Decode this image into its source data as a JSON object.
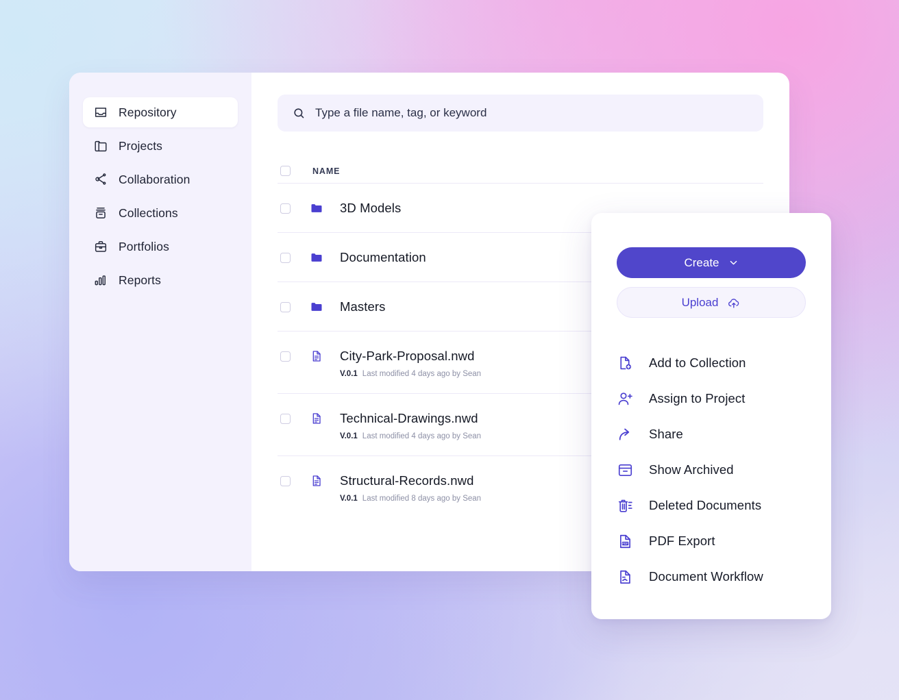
{
  "theme": {
    "accent": "#5046cb",
    "accent_light": "#4a3fd0",
    "panel_bg": "#ffffff",
    "sidebar_bg": "#f4f2fd",
    "field_bg": "#f4f2fd",
    "text": "#141824",
    "muted": "#8d90a6"
  },
  "sidebar": {
    "items": [
      {
        "label": "Repository",
        "icon": "inbox-icon",
        "active": true
      },
      {
        "label": "Projects",
        "icon": "folder-icon",
        "active": false
      },
      {
        "label": "Collaboration",
        "icon": "share-nodes-icon",
        "active": false
      },
      {
        "label": "Collections",
        "icon": "archive-icon",
        "active": false
      },
      {
        "label": "Portfolios",
        "icon": "briefcase-icon",
        "active": false
      },
      {
        "label": "Reports",
        "icon": "bar-chart-icon",
        "active": false
      }
    ]
  },
  "search": {
    "icon": "search-icon",
    "placeholder": "Type a file name, tag, or keyword",
    "value": ""
  },
  "table": {
    "columns": [
      "NAME"
    ],
    "select_all_checked": false,
    "rows": [
      {
        "name": "3D Models",
        "type": "folder",
        "icon": "folder-icon",
        "version": "",
        "meta": "",
        "checked": false
      },
      {
        "name": "Documentation",
        "type": "folder",
        "icon": "folder-icon",
        "version": "",
        "meta": "",
        "checked": false
      },
      {
        "name": "Masters",
        "type": "folder",
        "icon": "folder-icon",
        "version": "",
        "meta": "",
        "checked": false
      },
      {
        "name": "City-Park-Proposal.nwd",
        "type": "file",
        "icon": "document-icon",
        "version": "V.0.1",
        "meta": "Last modified 4 days ago by Sean",
        "checked": false
      },
      {
        "name": "Technical-Drawings.nwd",
        "type": "file",
        "icon": "document-icon",
        "version": "V.0.1",
        "meta": "Last modified 4 days ago by Sean",
        "checked": false
      },
      {
        "name": "Structural-Records.nwd",
        "type": "file",
        "icon": "document-icon",
        "version": "V.0.1",
        "meta": "Last modified 8 days ago by Sean",
        "checked": false
      }
    ]
  },
  "panel": {
    "create_button": {
      "label": "Create",
      "icon": "chevron-down-icon"
    },
    "upload_button": {
      "label": "Upload",
      "icon": "cloud-upload-icon"
    },
    "menu": [
      {
        "label": "Add to Collection",
        "icon": "file-plus-icon"
      },
      {
        "label": "Assign to Project",
        "icon": "user-plus-icon"
      },
      {
        "label": "Share",
        "icon": "share-arrow-icon"
      },
      {
        "label": "Show Archived",
        "icon": "archive-box-icon"
      },
      {
        "label": "Deleted Documents",
        "icon": "trash-list-icon"
      },
      {
        "label": "PDF Export",
        "icon": "pdf-file-icon"
      },
      {
        "label": "Document Workflow",
        "icon": "document-flow-icon"
      }
    ]
  }
}
